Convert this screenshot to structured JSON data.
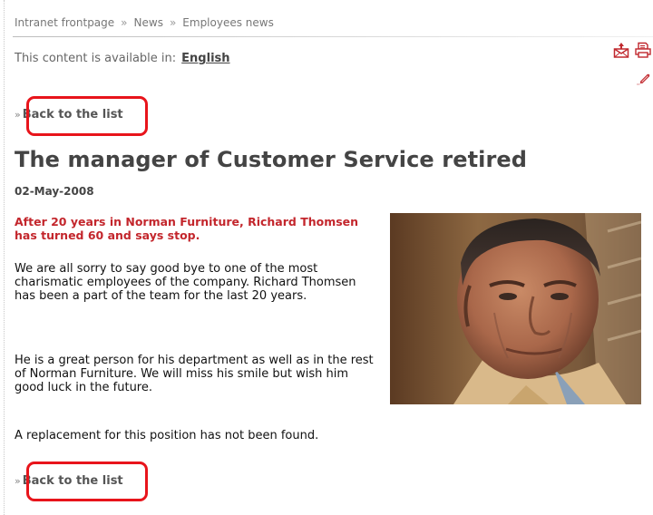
{
  "breadcrumb": {
    "items": [
      "Intranet frontpage",
      "News",
      "Employees news"
    ],
    "separator": "»"
  },
  "availability": {
    "label": "This content is available in:",
    "language": "English"
  },
  "toolbar": {
    "icons": [
      "send-by-email-icon",
      "print-icon",
      "edit-icon"
    ]
  },
  "nav": {
    "chevron": "»",
    "back_label": "Back to the list"
  },
  "article": {
    "title": "The manager of Customer Service retired",
    "date": "02-May-2008",
    "lead": "After 20 years in Norman Furniture, Richard Thomsen has turned 60 and says stop.",
    "paragraphs": [
      "We are all sorry to say good bye to one of the most charismatic employees of the company. Richard Thomsen has been a part of the team for the last 20 years.",
      "He is a great person for his department as well as in the rest of Norman Furniture. We will miss his smile but wish him good luck in the future.",
      "A replacement for this position has not been found."
    ]
  },
  "colors": {
    "lead_text": "#c3262c",
    "highlight": "#e8141b",
    "tool_icons": "#c0282e"
  }
}
